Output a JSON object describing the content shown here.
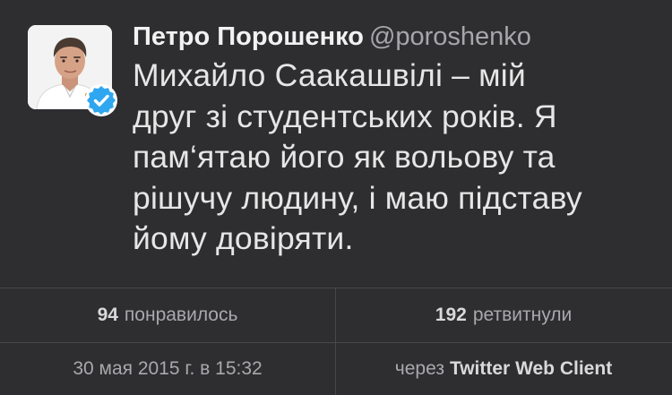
{
  "tweet": {
    "author_name": "Петро Порошенко",
    "author_handle": "@poroshenko",
    "text_lines": [
      "Михайло Саакашвілі – мій",
      "друг зі студентських років. Я",
      "пам‘ятаю його як вольову та",
      "рішучу людину, і маю підставу",
      "йому довіряти."
    ],
    "verified": true,
    "verified_color": "#2fa7f0"
  },
  "stats": {
    "likes_count": "94",
    "likes_label": "понравилось",
    "retweets_count": "192",
    "retweets_label": "ретвитнули"
  },
  "meta": {
    "timestamp": "30 мая 2015 г. в 15:32",
    "via_label": "через",
    "client": "Twitter Web Client"
  },
  "colors": {
    "background": "#2e2e30",
    "divider": "#48484b",
    "text_primary": "#e6e6e6",
    "text_secondary": "#a9a9ad"
  },
  "icons": {
    "avatar": "profile-photo",
    "badge": "verified-check-icon"
  }
}
